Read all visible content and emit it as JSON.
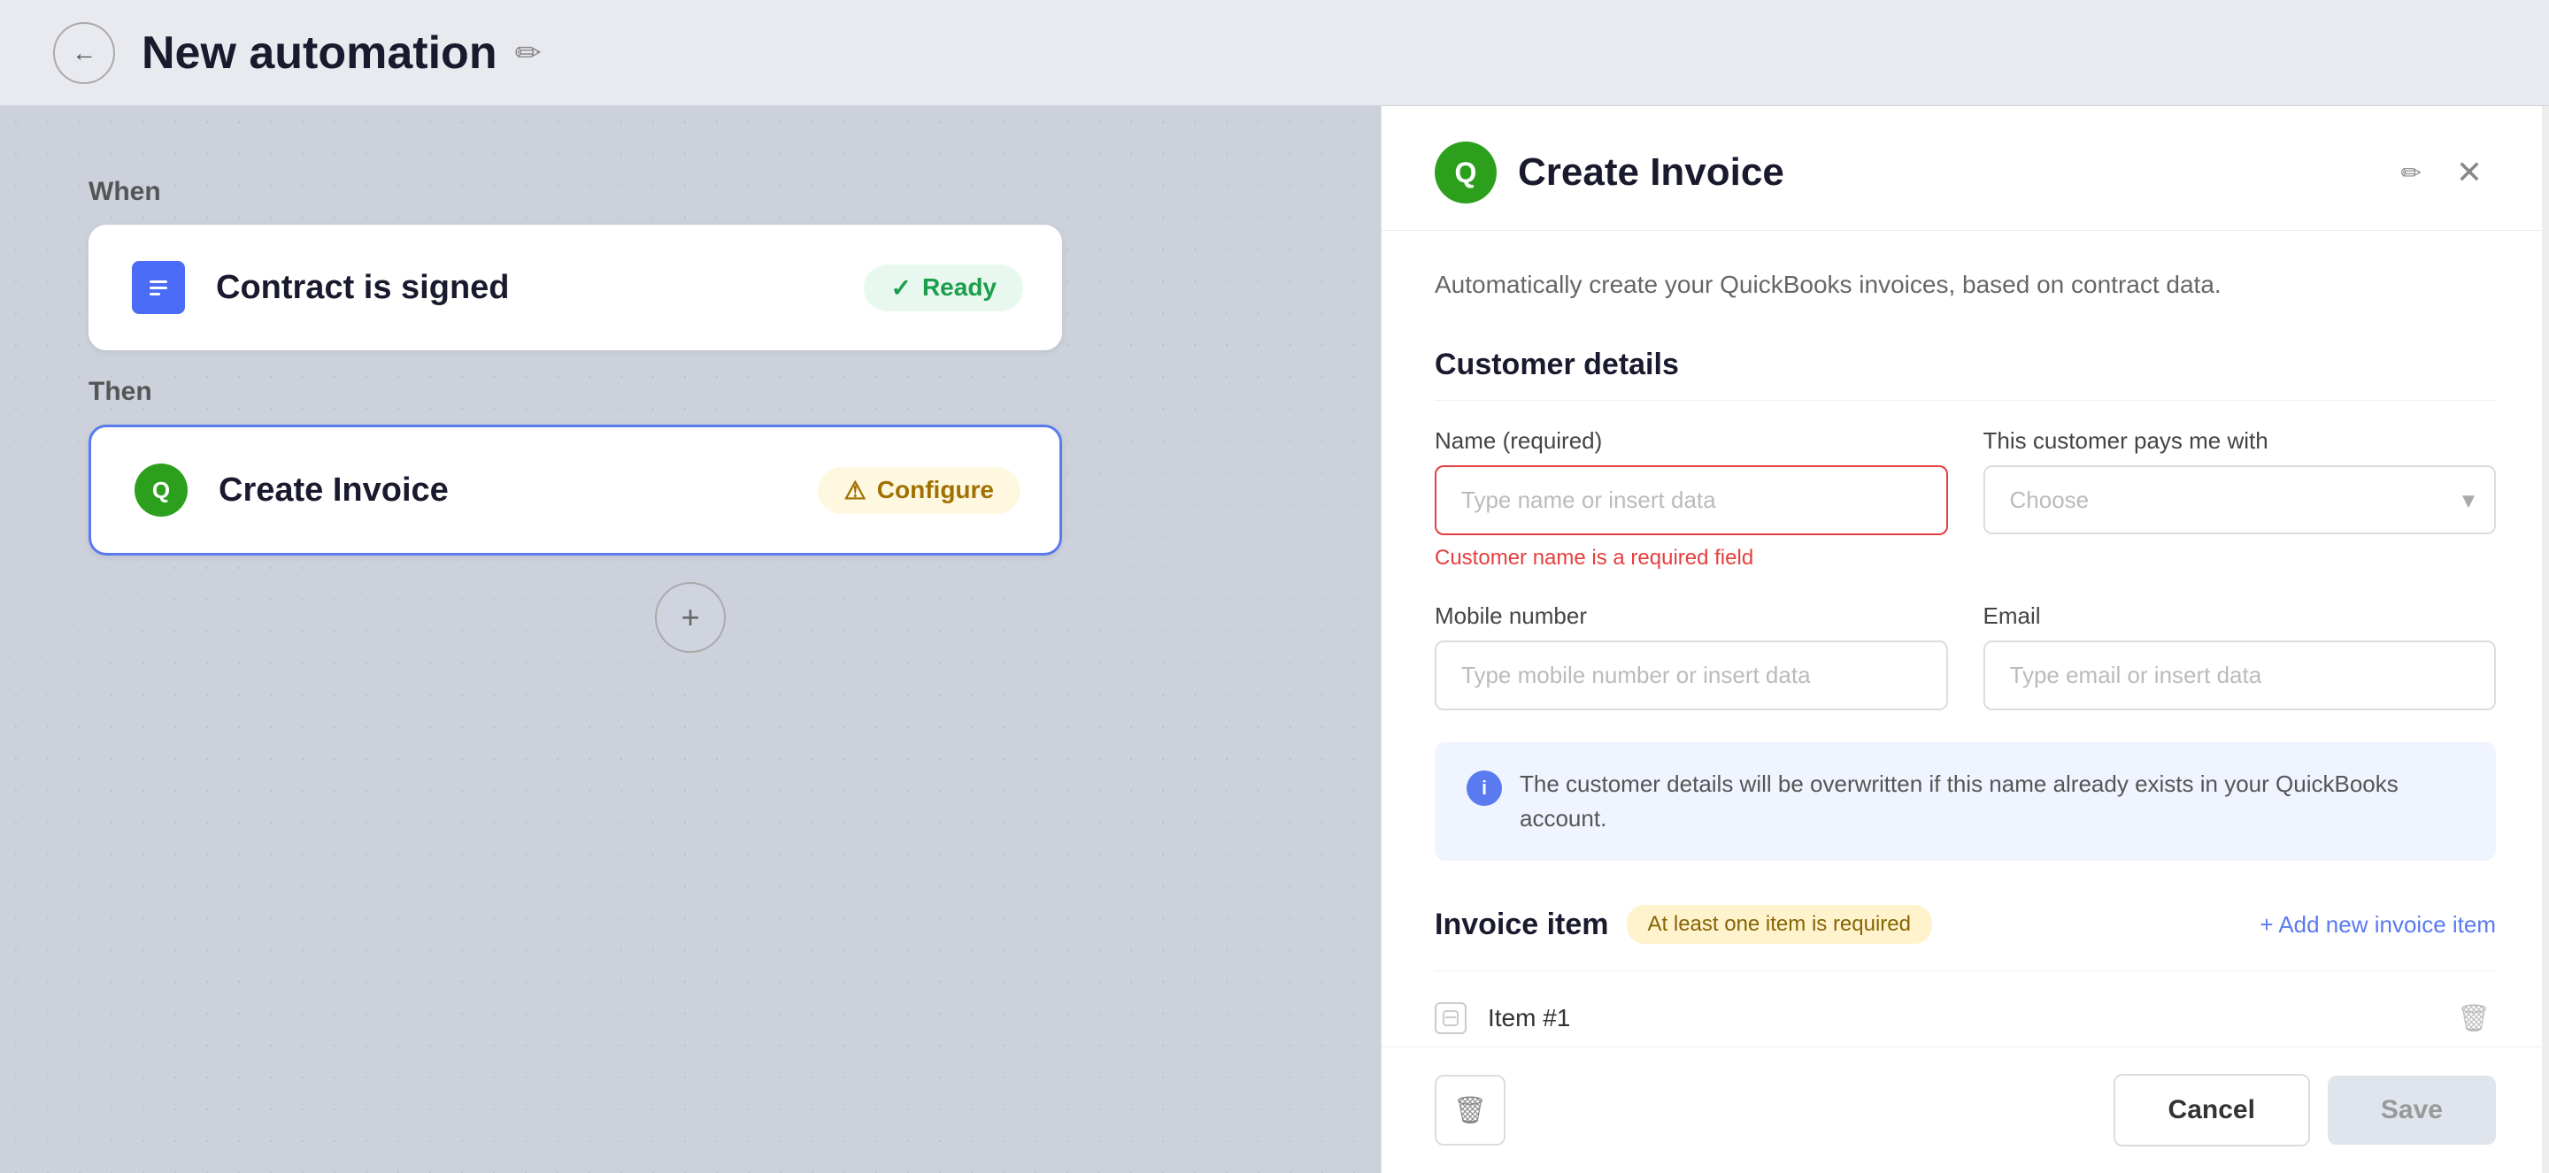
{
  "topBar": {
    "title": "New automation",
    "backLabel": "←",
    "editIcon": "✏"
  },
  "canvas": {
    "whenLabel": "When",
    "thenLabel": "Then",
    "triggerCard": {
      "title": "Contract is signed",
      "status": "Ready",
      "iconType": "document"
    },
    "actionCard": {
      "title": "Create Invoice",
      "status": "Configure",
      "iconType": "quickbooks"
    },
    "addButtonLabel": "+"
  },
  "panel": {
    "title": "Create Invoice",
    "editIcon": "✏",
    "closeIcon": "✕",
    "description": "Automatically create your QuickBooks invoices, based on contract data.",
    "customerSection": {
      "title": "Customer details",
      "nameField": {
        "label": "Name (required)",
        "placeholder": "Type name or insert data",
        "errorText": "Customer name is a required field"
      },
      "paymentField": {
        "label": "This customer pays me with",
        "placeholder": "Choose",
        "options": []
      },
      "mobileField": {
        "label": "Mobile number",
        "placeholder": "Type mobile number or insert data"
      },
      "emailField": {
        "label": "Email",
        "placeholder": "Type email or insert data"
      },
      "infoText": "The customer details will be overwritten if this name already exists in your QuickBooks account."
    },
    "invoiceSection": {
      "title": "Invoice item",
      "requiredBadge": "At least one item is required",
      "addItemLabel": "+ Add new invoice item",
      "items": [
        {
          "number": "Item #1"
        }
      ]
    },
    "footer": {
      "cancelLabel": "Cancel",
      "saveLabel": "Save",
      "deleteIcon": "🗑"
    }
  }
}
